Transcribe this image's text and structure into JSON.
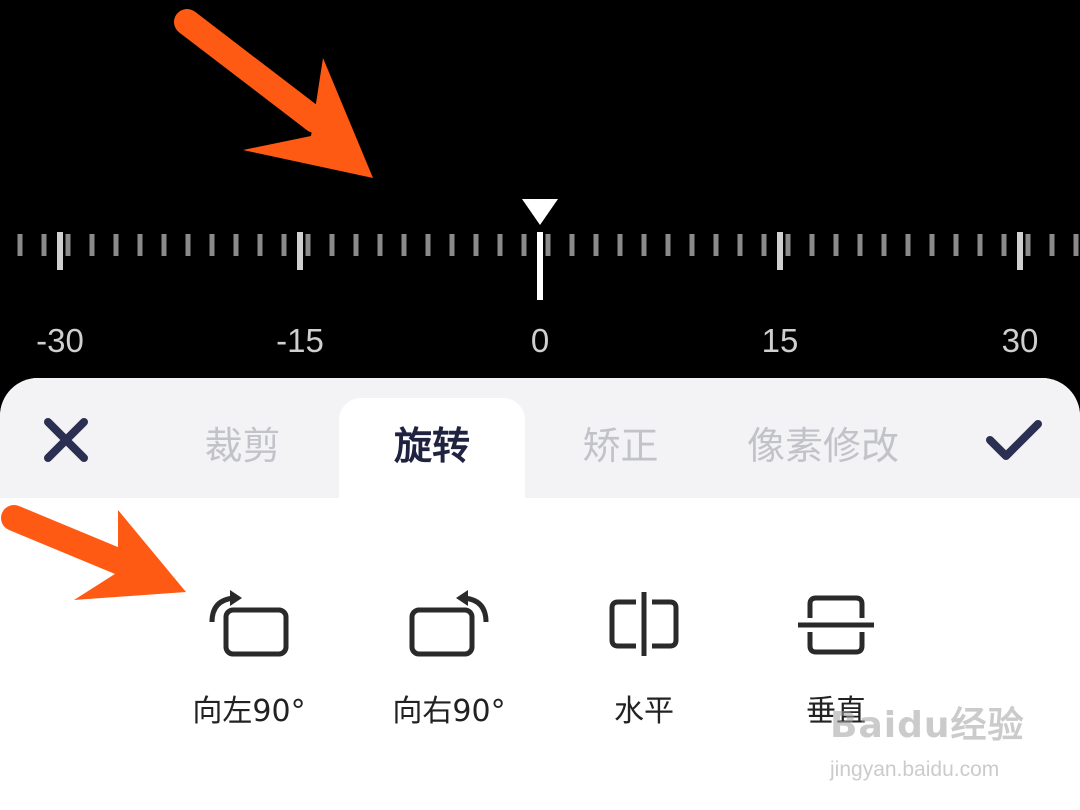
{
  "ruler": {
    "min": -34,
    "max": 34,
    "minor_step": 1.5,
    "major_step": 15,
    "current_value": 0,
    "labels": [
      "-30",
      "-15",
      "0",
      "15",
      "30"
    ],
    "major_values": [
      -30,
      -15,
      0,
      15,
      30
    ]
  },
  "toolbar": {
    "tabs": [
      {
        "label": "裁剪",
        "active": false
      },
      {
        "label": "旋转",
        "active": true
      },
      {
        "label": "矫正",
        "active": false
      },
      {
        "label": "像素修改",
        "active": false
      }
    ]
  },
  "tools": [
    {
      "label": "向左90°",
      "icon": "rotate-left-icon"
    },
    {
      "label": "向右90°",
      "icon": "rotate-right-icon"
    },
    {
      "label": "水平",
      "icon": "flip-horizontal-icon"
    },
    {
      "label": "垂直",
      "icon": "flip-vertical-icon"
    }
  ],
  "watermark": {
    "brand": "Baidu经验",
    "url": "jingyan.baidu.com"
  },
  "colors": {
    "background": "#000000",
    "panel": "#ffffff",
    "tabbar": "#f3f3f5",
    "active_tab_text": "#1f2340",
    "inactive_tab_text": "#c2c3c9",
    "icon": "#2a2a2a",
    "annotation_arrow": "#ff5a14"
  }
}
